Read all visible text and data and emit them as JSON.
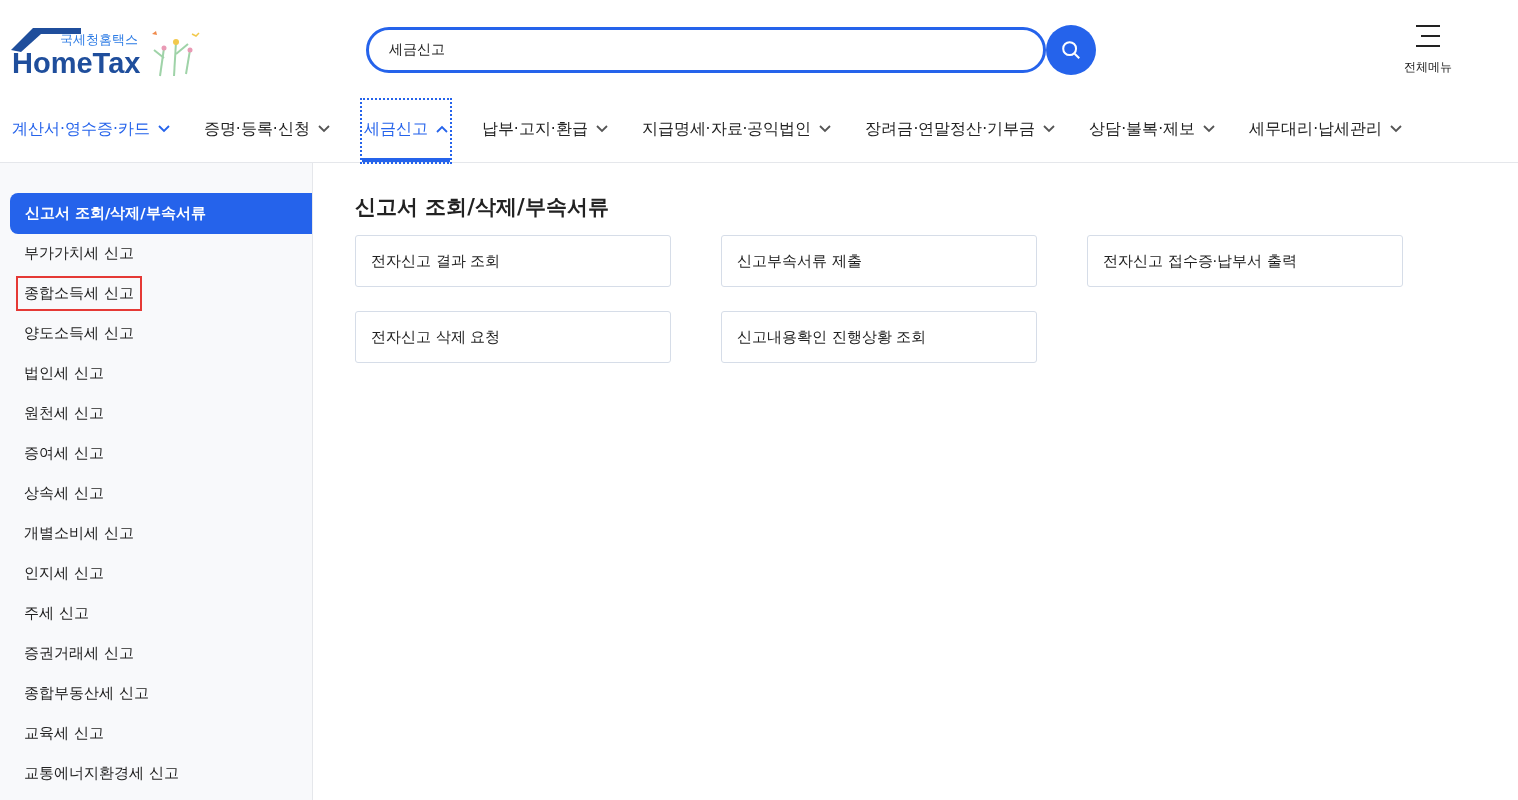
{
  "logo": {
    "subtitle": "국세청홈택스",
    "title": "HomeTax"
  },
  "search": {
    "value": "세금신고"
  },
  "all_menu": {
    "label": "전체메뉴"
  },
  "nav": [
    {
      "label": "계산서·영수증·카드",
      "selected": false,
      "hovered": true,
      "expanded": false
    },
    {
      "label": "증명·등록·신청",
      "selected": false,
      "hovered": false,
      "expanded": false
    },
    {
      "label": "세금신고",
      "selected": true,
      "hovered": false,
      "expanded": true
    },
    {
      "label": "납부·고지·환급",
      "selected": false,
      "hovered": false,
      "expanded": false
    },
    {
      "label": "지급명세·자료·공익법인",
      "selected": false,
      "hovered": false,
      "expanded": false
    },
    {
      "label": "장려금·연말정산·기부금",
      "selected": false,
      "hovered": false,
      "expanded": false
    },
    {
      "label": "상담·불복·제보",
      "selected": false,
      "hovered": false,
      "expanded": false
    },
    {
      "label": "세무대리·납세관리",
      "selected": false,
      "hovered": false,
      "expanded": false
    }
  ],
  "sidebar": {
    "items": [
      {
        "label": "신고서 조회/삭제/부속서류",
        "selected": true,
        "marked": false
      },
      {
        "label": "부가가치세 신고",
        "selected": false,
        "marked": false
      },
      {
        "label": "종합소득세 신고",
        "selected": false,
        "marked": true
      },
      {
        "label": "양도소득세 신고",
        "selected": false,
        "marked": false
      },
      {
        "label": "법인세 신고",
        "selected": false,
        "marked": false
      },
      {
        "label": "원천세 신고",
        "selected": false,
        "marked": false
      },
      {
        "label": "증여세 신고",
        "selected": false,
        "marked": false
      },
      {
        "label": "상속세 신고",
        "selected": false,
        "marked": false
      },
      {
        "label": "개별소비세 신고",
        "selected": false,
        "marked": false
      },
      {
        "label": "인지세 신고",
        "selected": false,
        "marked": false
      },
      {
        "label": "주세 신고",
        "selected": false,
        "marked": false
      },
      {
        "label": "증권거래세 신고",
        "selected": false,
        "marked": false
      },
      {
        "label": "종합부동산세 신고",
        "selected": false,
        "marked": false
      },
      {
        "label": "교육세 신고",
        "selected": false,
        "marked": false
      },
      {
        "label": "교통에너지환경세 신고",
        "selected": false,
        "marked": false
      }
    ]
  },
  "content": {
    "title": "신고서 조회/삭제/부속서류",
    "links": [
      "전자신고 결과 조회",
      "신고부속서류 제출",
      "전자신고 접수증·납부서 출력",
      "전자신고 삭제 요청",
      "신고내용확인 진행상황 조회"
    ]
  }
}
